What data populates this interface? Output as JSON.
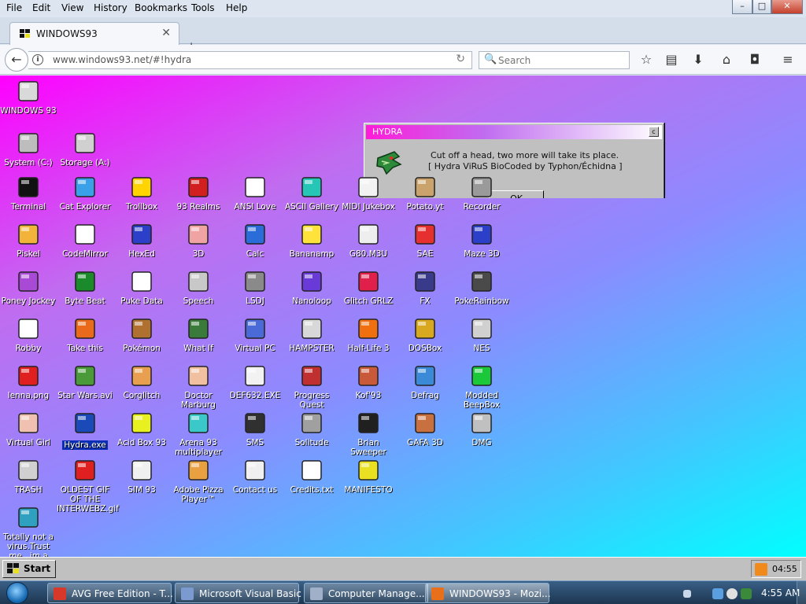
{
  "menu": [
    "File",
    "Edit",
    "View",
    "History",
    "Bookmarks",
    "Tools",
    "Help"
  ],
  "window_controls": {
    "minimize": "–",
    "maximize": "□",
    "close": "✕"
  },
  "tab": {
    "title": "WINDOWS93",
    "close": "✕",
    "new": "+"
  },
  "nav": {
    "back": "←",
    "info": "i",
    "url": "www.windows93.net/#!hydra",
    "reload": "↻",
    "search_placeholder": "Search",
    "search_icon": "🔍",
    "toolbar": [
      {
        "name": "bookmark-star-icon",
        "glyph": "☆"
      },
      {
        "name": "reading-list-icon",
        "glyph": "▤"
      },
      {
        "name": "download-icon",
        "glyph": "⬇"
      },
      {
        "name": "home-icon",
        "glyph": "⌂"
      },
      {
        "name": "pocket-icon",
        "glyph": "◘"
      },
      {
        "name": "hamburger-menu-icon",
        "glyph": "≡"
      }
    ]
  },
  "desktop": {
    "icons": [
      {
        "label": "WINDOWS 93",
        "icon": "computer-icon",
        "color": "#d9d9d9"
      },
      {
        "label": "System (C:)",
        "icon": "hard-drive-icon",
        "color": "#bdbdbd"
      },
      {
        "label": "Storage (A:)",
        "icon": "floppy-drive-icon",
        "color": "#d0d0d0"
      },
      {
        "label": "Terminal",
        "icon": "terminal-icon",
        "color": "#111111"
      },
      {
        "label": "Cat Explorer",
        "icon": "cat-explorer-icon",
        "color": "#3aa0e8"
      },
      {
        "label": "Trollbox",
        "icon": "trollbox-icon",
        "color": "#ffd400"
      },
      {
        "label": "93 Realms",
        "icon": "realms-icon",
        "color": "#d21f1f"
      },
      {
        "label": "ANSI Love",
        "icon": "ansi-love-icon",
        "color": "#ffffff"
      },
      {
        "label": "ASCII Gallery",
        "icon": "ascii-gallery-icon",
        "color": "#25c6b6"
      },
      {
        "label": "MIDI Jukebox",
        "icon": "midi-jukebox-icon",
        "color": "#f2f2f2"
      },
      {
        "label": "Potato.yt",
        "icon": "potato-icon",
        "color": "#c9a36b"
      },
      {
        "label": "Recorder",
        "icon": "recorder-icon",
        "color": "#9a9a9a"
      },
      {
        "label": "Piskel",
        "icon": "piskel-icon",
        "color": "#f2b33a"
      },
      {
        "label": "CodeMirror",
        "icon": "codemirror-icon",
        "color": "#ffffff"
      },
      {
        "label": "HexEd",
        "icon": "hexed-icon",
        "color": "#2b3fc8"
      },
      {
        "label": "3D",
        "icon": "teapot-icon",
        "color": "#f0a3a3"
      },
      {
        "label": "Calc",
        "icon": "calculator-icon",
        "color": "#2a6cd8"
      },
      {
        "label": "Bananamp",
        "icon": "banana-icon",
        "color": "#ffe23a"
      },
      {
        "label": "G80.M3U",
        "icon": "playlist-icon",
        "color": "#eeeeee"
      },
      {
        "label": "SAE",
        "icon": "amiga-ball-icon",
        "color": "#e63030"
      },
      {
        "label": "Maze 3D",
        "icon": "maze-icon",
        "color": "#2b3fc8"
      },
      {
        "label": "Poney Jockey",
        "icon": "pony-icon",
        "color": "#a84ad6"
      },
      {
        "label": "Byte Beat",
        "icon": "bytebeat-icon",
        "color": "#1a8a2a"
      },
      {
        "label": "Puke Data",
        "icon": "puke-data-icon",
        "color": "#ffffff"
      },
      {
        "label": "Speech",
        "icon": "speech-icon",
        "color": "#c8c8c8"
      },
      {
        "label": "LSDJ",
        "icon": "lsdj-icon",
        "color": "#8a8a8a"
      },
      {
        "label": "Nanoloop",
        "icon": "nanoloop-icon",
        "color": "#6a3ad8"
      },
      {
        "label": "Glitch GRLZ",
        "icon": "glitch-lips-icon",
        "color": "#e0204a"
      },
      {
        "label": "FX",
        "icon": "atom-icon",
        "color": "#3a3a8a"
      },
      {
        "label": "PokeRainbow",
        "icon": "pokerainbow-icon",
        "color": "#4a4a4a"
      },
      {
        "label": "Robby",
        "icon": "robby-icon",
        "color": "#ffffff"
      },
      {
        "label": "Take this",
        "icon": "take-this-icon",
        "color": "#e86a1a"
      },
      {
        "label": "Pokémon",
        "icon": "pokemon-icon",
        "color": "#b07030"
      },
      {
        "label": "What If",
        "icon": "what-if-icon",
        "color": "#3a7a3a"
      },
      {
        "label": "Virtual PC",
        "icon": "virtual-pc-icon",
        "color": "#4a6ad8"
      },
      {
        "label": "HAMPSTER",
        "icon": "hampster-icon",
        "color": "#d8d8d8"
      },
      {
        "label": "Half-Life 3",
        "icon": "half-life-icon",
        "color": "#f07010"
      },
      {
        "label": "DOSBox",
        "icon": "dosbox-icon",
        "color": "#d8a820"
      },
      {
        "label": "NES",
        "icon": "nes-icon",
        "color": "#d0d0d0"
      },
      {
        "label": "lenna.png",
        "icon": "image-file-icon",
        "color": "#e02020"
      },
      {
        "label": "Star Wars.avi",
        "icon": "yoda-icon",
        "color": "#4a9a3a"
      },
      {
        "label": "Corglitch",
        "icon": "corgi-icon",
        "color": "#e8a050"
      },
      {
        "label": "Doctor Marburg",
        "icon": "doctor-icon",
        "color": "#f0c0a0"
      },
      {
        "label": "DEF632.EXE",
        "icon": "def632-icon",
        "color": "#f2f2f2"
      },
      {
        "label": "Progress Quest",
        "icon": "progress-quest-icon",
        "color": "#c03030"
      },
      {
        "label": "Kof'93",
        "icon": "kof-icon",
        "color": "#c85a3a"
      },
      {
        "label": "Defrag",
        "icon": "defrag-icon",
        "color": "#3a8ad8"
      },
      {
        "label": "Modded BeepBox",
        "icon": "beepbox-icon",
        "color": "#1ac83a"
      },
      {
        "label": "Virtual Girl",
        "icon": "virtual-girl-icon",
        "color": "#f0c0b0"
      },
      {
        "label": "Hydra.exe",
        "icon": "hydra-icon",
        "color": "#1a4ab8",
        "selected": true
      },
      {
        "label": "Acid Box 93",
        "icon": "acid-smiley-icon",
        "color": "#e8f020"
      },
      {
        "label": "Arena 93 multiplayer",
        "icon": "arena-cube-icon",
        "color": "#3ac8c8"
      },
      {
        "label": "SMS",
        "icon": "sms-console-icon",
        "color": "#303030"
      },
      {
        "label": "Solitude",
        "icon": "solitude-icon",
        "color": "#a0a0a0"
      },
      {
        "label": "Brian Sweeper",
        "icon": "mine-icon",
        "color": "#202020"
      },
      {
        "label": "GAFA 3D",
        "icon": "gafa-icon",
        "color": "#c87040"
      },
      {
        "label": "DMG",
        "icon": "dmg-icon",
        "color": "#c0c0c0"
      },
      {
        "label": "TRASH",
        "icon": "trash-icon",
        "color": "#d0d0d0"
      },
      {
        "label": "OLDEST GIF OF THE INTERWEBZ.gif",
        "icon": "gif-file-icon",
        "color": "#e02020"
      },
      {
        "label": "SIM 93",
        "icon": "sim-icon",
        "color": "#f0f0f0"
      },
      {
        "label": "Adobe Pizza Player™",
        "icon": "pizza-icon",
        "color": "#e8a040"
      },
      {
        "label": "Contact us",
        "icon": "contact-icon",
        "color": "#f0f0f0"
      },
      {
        "label": "Credits.txt",
        "icon": "text-file-icon",
        "color": "#ffffff"
      },
      {
        "label": "MANIFESTO",
        "icon": "question-mark-icon",
        "color": "#e8e020"
      },
      {
        "label": "Totally not a virus.Trust me...im a",
        "icon": "dolphin-icon",
        "color": "#30a0c0"
      }
    ]
  },
  "hydra_dialog": {
    "title": "HYDRA",
    "close": "c",
    "line1": "Cut off a head, two more will take its place.",
    "line2": "[ Hydra ViRuS BioCoded by Typhon/Échidna ]",
    "ok": "OK"
  },
  "w93_taskbar": {
    "start": "Start",
    "time": "04:55"
  },
  "win7_taskbar": {
    "tasks": [
      {
        "label": "AVG Free Edition - T...",
        "icon_color": "#d8382a",
        "active": false
      },
      {
        "label": "Microsoft Visual Basic",
        "icon_color": "#7a9ad0",
        "active": false
      },
      {
        "label": "Computer Manage...",
        "icon_color": "#a0b0c8",
        "active": false
      },
      {
        "label": "WINDOWS93 - Mozi...",
        "icon_color": "#e8701a",
        "active": true
      }
    ],
    "clock": "4:55 AM"
  }
}
